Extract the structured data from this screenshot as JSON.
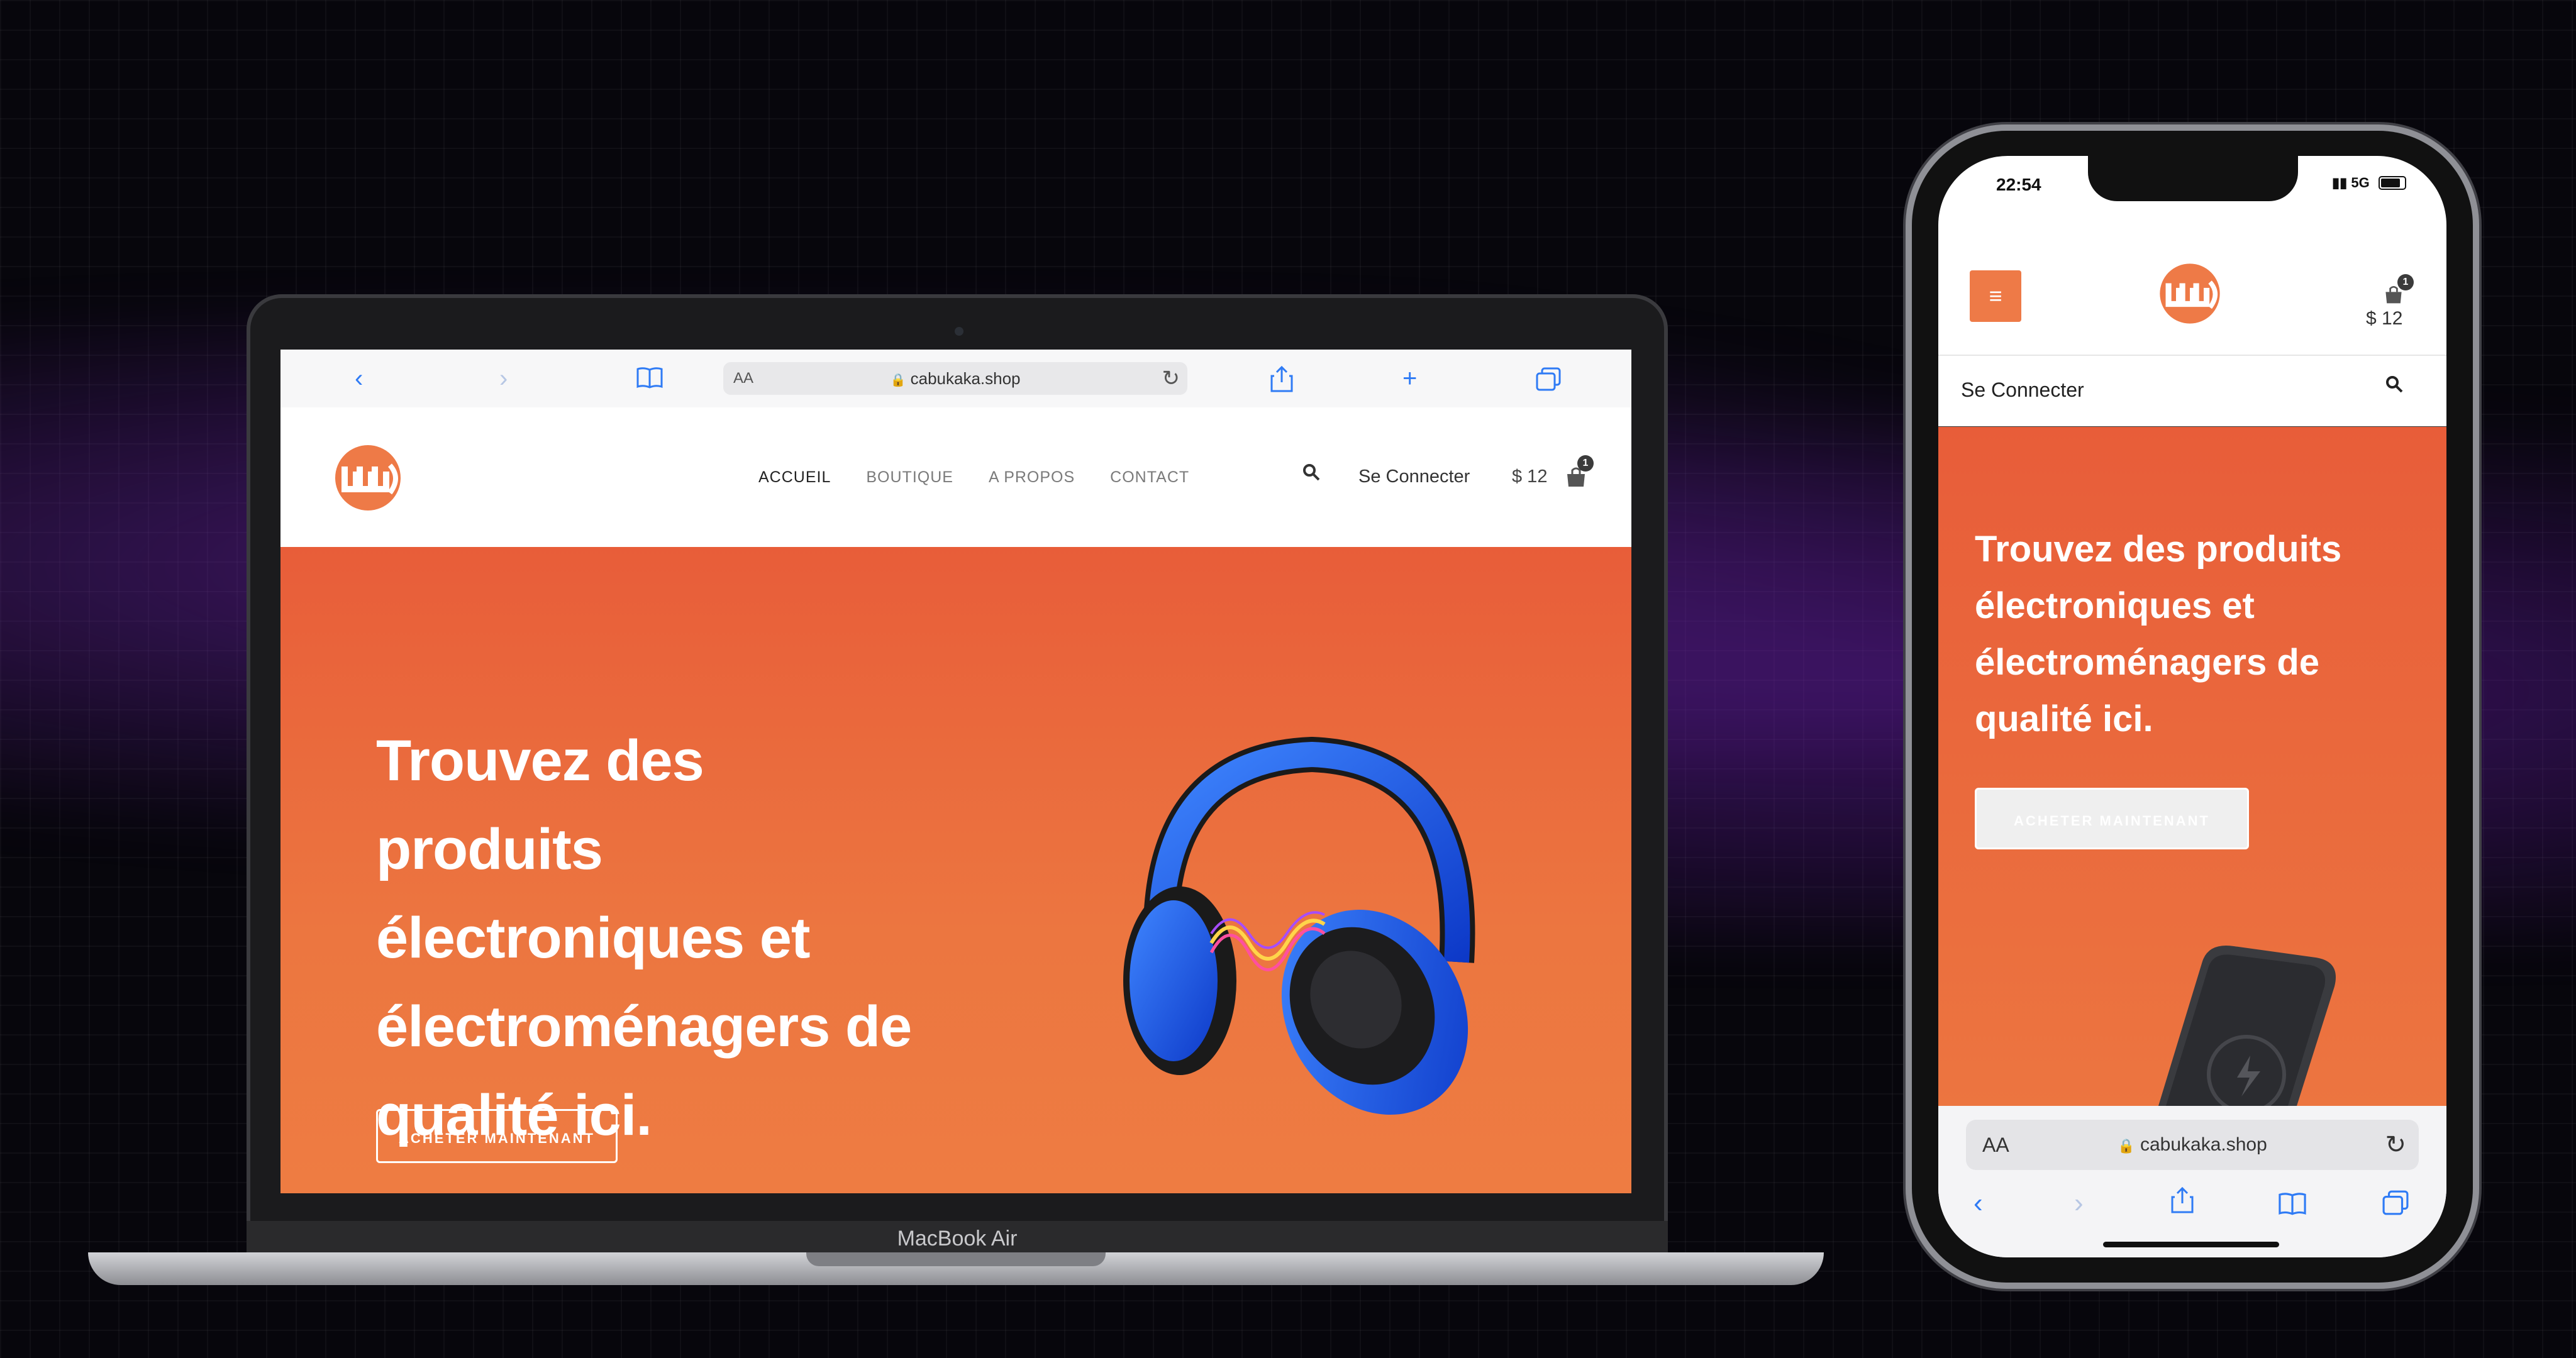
{
  "laptop": {
    "label": "MacBook Air",
    "browser": {
      "aa": "AA",
      "url": "cabukaka.shop",
      "icons": [
        "back-icon",
        "forward-icon",
        "bookmarks-icon",
        "lock-icon",
        "reload-icon",
        "share-icon",
        "new-tab-icon",
        "tabs-icon"
      ]
    },
    "site": {
      "nav": [
        "ACCUEIL",
        "BOUTIQUE",
        "A PROPOS",
        "CONTACT"
      ],
      "signin": "Se Connecter",
      "cart_total": "$ 12",
      "cart_count": "1",
      "hero_title": "Trouvez des produits électroniques et électroménagers de qualité ici.",
      "hero_button": "ACHETER MAINTENANT"
    }
  },
  "phone": {
    "status": {
      "time": "22:54",
      "network": "5G"
    },
    "site": {
      "cart_total": "$ 12",
      "cart_count": "1",
      "signin": "Se Connecter",
      "hero_title": "Trouvez des produits électroniques et électroménagers de qualité ici.",
      "hero_button": "ACHETER MAINTENANT"
    },
    "browser": {
      "aa": "AA",
      "url": "cabukaka.shop"
    }
  },
  "colors": {
    "brand": "#ee7a47",
    "hero_top": "#e85d39",
    "hero_bottom": "#ee7c42",
    "safari_blue": "#2f7bf5"
  }
}
